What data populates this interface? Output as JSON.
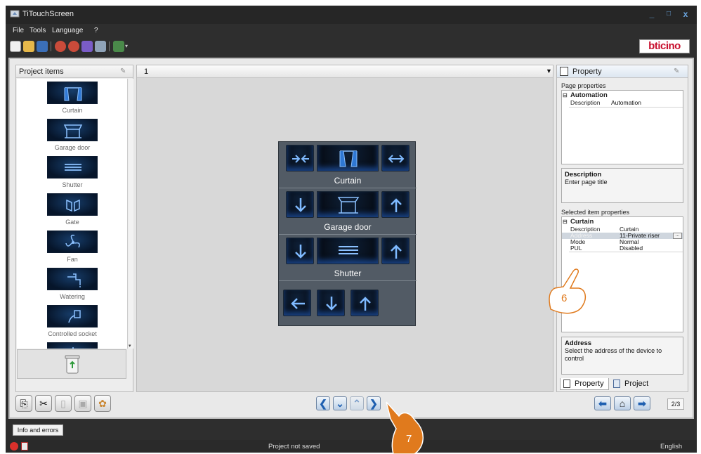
{
  "window": {
    "title": "TiTouchScreen",
    "minimize": "_",
    "maximize": "□",
    "close": "x"
  },
  "menu": [
    "File",
    "Tools",
    "Language",
    "?"
  ],
  "brand": "bticino",
  "left_panel": {
    "title": "Project items",
    "items": [
      {
        "label": "Curtain",
        "icon": "curtain-icon"
      },
      {
        "label": "Garage door",
        "icon": "garage-icon"
      },
      {
        "label": "Shutter",
        "icon": "shutter-icon"
      },
      {
        "label": "Gate",
        "icon": "gate-icon"
      },
      {
        "label": "Fan",
        "icon": "fan-icon"
      },
      {
        "label": "Watering",
        "icon": "watering-icon"
      },
      {
        "label": "Controlled socket",
        "icon": "socket-icon"
      }
    ]
  },
  "canvas": {
    "page": "1",
    "device": {
      "rows": [
        {
          "label": "Curtain"
        },
        {
          "label": "Garage door"
        },
        {
          "label": "Shutter"
        }
      ]
    }
  },
  "property_panel": {
    "title": "Property",
    "page_properties_label": "Page properties",
    "page_group": "Automation",
    "page_rows": [
      {
        "key": "Description",
        "value": "Automation"
      }
    ],
    "description_title": "Description",
    "description_text": "Enter page title",
    "selected_label": "Selected item properties",
    "selected_group": "Curtain",
    "selected_rows": [
      {
        "key": "Description",
        "value": "Curtain"
      },
      {
        "key": "Address",
        "value": "11-Private riser"
      },
      {
        "key": "Mode",
        "value": "Normal"
      },
      {
        "key": "PUL",
        "value": "Disabled"
      }
    ],
    "browse_button": "...",
    "address_title": "Address",
    "address_text": "Select the address of the device to control",
    "tabs": [
      "Property",
      "Project"
    ]
  },
  "bottom": {
    "page_indicator": "2/3",
    "info_tab": "Info and errors"
  },
  "status": {
    "text": "Project not saved",
    "language": "English"
  },
  "callouts": [
    "6",
    "7"
  ],
  "colors": {
    "accent": "#e07a1d",
    "brand_red": "#c8102e",
    "device_bg": "#525b65"
  }
}
